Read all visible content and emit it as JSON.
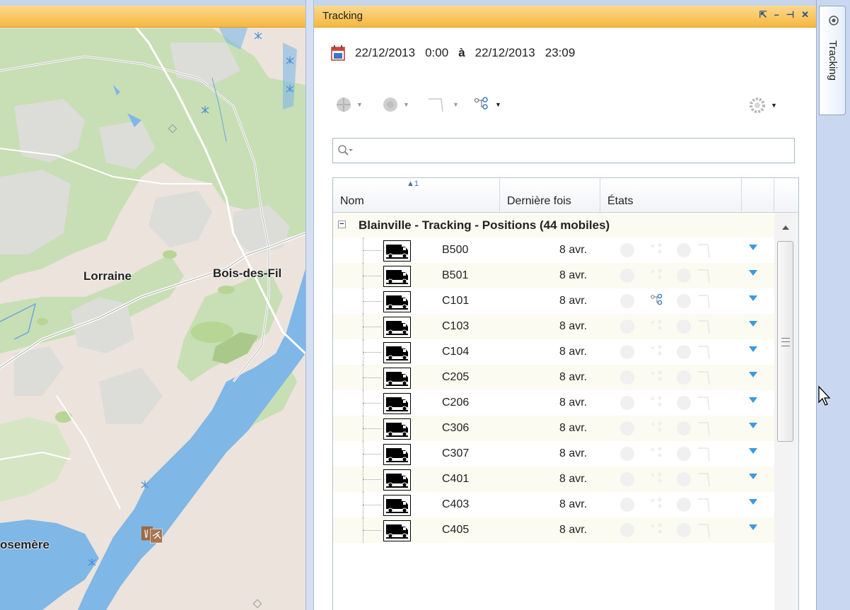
{
  "map": {
    "labels": {
      "lorraine": "Lorraine",
      "bois_des_fil": "Bois-des-Fil",
      "rosemere": "osemère"
    }
  },
  "panel": {
    "title": "Tracking",
    "title_icons": [
      "undock-icon",
      "minimize-icon",
      "pin-icon",
      "close-icon"
    ],
    "date_range": {
      "start_date": "22/12/2013",
      "start_time": "0:00",
      "separator": "à",
      "end_date": "22/12/2013",
      "end_time": "23:09"
    },
    "search": {
      "placeholder": ""
    },
    "grid": {
      "columns": [
        "Nom",
        "Dernière fois",
        "États"
      ],
      "sort_indicator": "1",
      "group": "Blainville - Tracking - Positions (44 mobiles)",
      "rows": [
        {
          "name": "B500",
          "last": "8 avr."
        },
        {
          "name": "B501",
          "last": "8 avr."
        },
        {
          "name": "C101",
          "last": "8 avr."
        },
        {
          "name": "C103",
          "last": "8 avr."
        },
        {
          "name": "C104",
          "last": "8 avr."
        },
        {
          "name": "C205",
          "last": "8 avr."
        },
        {
          "name": "C206",
          "last": "8 avr."
        },
        {
          "name": "C306",
          "last": "8 avr."
        },
        {
          "name": "C307",
          "last": "8 avr."
        },
        {
          "name": "C401",
          "last": "8 avr."
        },
        {
          "name": "C403",
          "last": "8 avr."
        },
        {
          "name": "C405",
          "last": "8 avr."
        }
      ]
    }
  },
  "dock": {
    "tab_label": "Tracking"
  },
  "colors": {
    "titlebar": "#f6b83e",
    "accent_blue": "#3a9ade",
    "row_alt": "#fbfbf1"
  }
}
